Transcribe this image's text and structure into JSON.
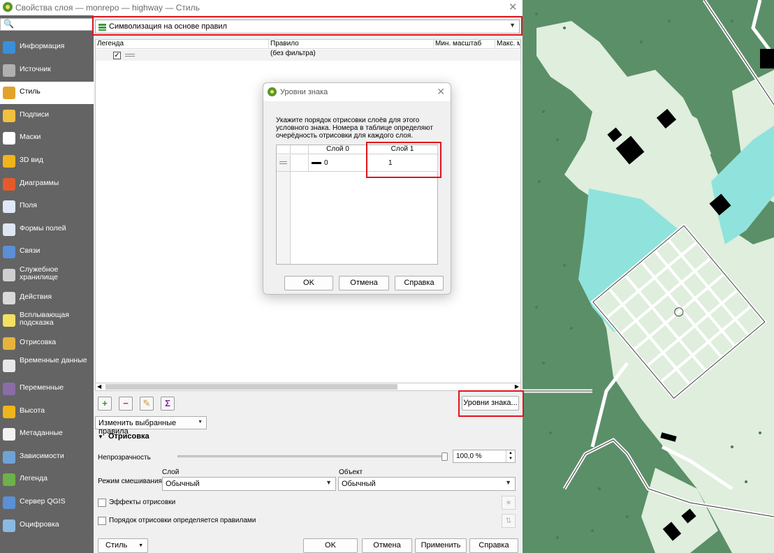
{
  "window": {
    "title": "Свойства слоя — monrepo — highway — Стиль",
    "close": "✕"
  },
  "sidebar": {
    "search_glyph": "🔍",
    "items": [
      {
        "label": "Информация",
        "icon": "info-icon",
        "color": "#3b8ed8"
      },
      {
        "label": "Источник",
        "icon": "source-icon",
        "color": "#b0b0b0"
      },
      {
        "label": "Стиль",
        "icon": "style-brush-icon",
        "color": "#e2a32b"
      },
      {
        "label": "Подписи",
        "icon": "labels-icon",
        "color": "#f2c040"
      },
      {
        "label": "Маски",
        "icon": "masks-icon",
        "color": "#ffffff"
      },
      {
        "label": "3D вид",
        "icon": "3d-view-icon",
        "color": "#f0b51c"
      },
      {
        "label": "Диаграммы",
        "icon": "diagrams-icon",
        "color": "#e45b2b"
      },
      {
        "label": "Поля",
        "icon": "fields-icon",
        "color": "#e0e8f5"
      },
      {
        "label": "Формы полей",
        "icon": "field-forms-icon",
        "color": "#dfe6f2"
      },
      {
        "label": "Связи",
        "icon": "joins-icon",
        "color": "#5b8fd6"
      },
      {
        "label": "Служебное хранилище",
        "icon": "auxiliary-storage-icon",
        "color": "#cfcfcf"
      },
      {
        "label": "Действия",
        "icon": "actions-icon",
        "color": "#d9d9d9"
      },
      {
        "label": "Всплывающая подсказка",
        "icon": "map-tips-icon",
        "color": "#f3df63"
      },
      {
        "label": "Отрисовка",
        "icon": "rendering-icon",
        "color": "#e6b43d"
      },
      {
        "label": "Временные данные",
        "icon": "temporal-icon",
        "color": "#e8e8e8"
      },
      {
        "label": "Переменные",
        "icon": "variables-icon",
        "color": "#8b6ca6"
      },
      {
        "label": "Высота",
        "icon": "elevation-icon",
        "color": "#f0b51c"
      },
      {
        "label": "Метаданные",
        "icon": "metadata-icon",
        "color": "#f2f2f2"
      },
      {
        "label": "Зависимости",
        "icon": "dependencies-icon",
        "color": "#6fa3d6"
      },
      {
        "label": "Легенда",
        "icon": "legend-icon",
        "color": "#6db14a"
      },
      {
        "label": "Сервер QGIS",
        "icon": "qgis-server-icon",
        "color": "#5b8fd6"
      },
      {
        "label": "Оцифровка",
        "icon": "digitizing-icon",
        "color": "#8ab9e3"
      }
    ]
  },
  "renderer_combo": {
    "value": "Символизация на основе правил"
  },
  "rules_tree": {
    "headers": [
      "Легенда",
      "Правило",
      "Мин. масштаб",
      "Макс. м"
    ],
    "rows": [
      {
        "rule": "(без фильтра)",
        "checked": "✓"
      }
    ]
  },
  "toolbar": {
    "add": "+",
    "remove": "−",
    "edit": "✎",
    "sum": "Σ"
  },
  "symbol_levels_button": "Уровни знака...",
  "refine_rules": "Изменить выбранные правила",
  "rendering_section": {
    "title": "Отрисовка",
    "opacity_label": "Непрозрачность",
    "opacity_value": "100,0 %",
    "blend_label": "Режим смешивания",
    "layer_label": "Слой",
    "feature_label": "Объект",
    "layer_blend": "Обычный",
    "feature_blend": "Обычный",
    "effects_label": "Эффекты отрисовки",
    "order_label": "Порядок отрисовки определяется правилами"
  },
  "bottom": {
    "style": "Стиль",
    "ok": "OK",
    "cancel": "Отмена",
    "apply": "Применить",
    "help": "Справка"
  },
  "modal": {
    "title": "Уровни знака",
    "description": "Укажите порядок отрисовки слоёв для этого условного знака. Номера в таблице определяют очерёдность отрисовки для каждого слоя.",
    "col0": "Слой 0",
    "col1": "Слой 1",
    "val0": "0",
    "val1": "1",
    "ok": "OK",
    "cancel": "Отмена",
    "help": "Справка"
  },
  "colors": {
    "forest": "#5b8f68",
    "meadow": "#dfeedd",
    "water": "#8fe3dc",
    "building": "#000000",
    "road": "#ffffff",
    "highlight": "#e0141e"
  }
}
